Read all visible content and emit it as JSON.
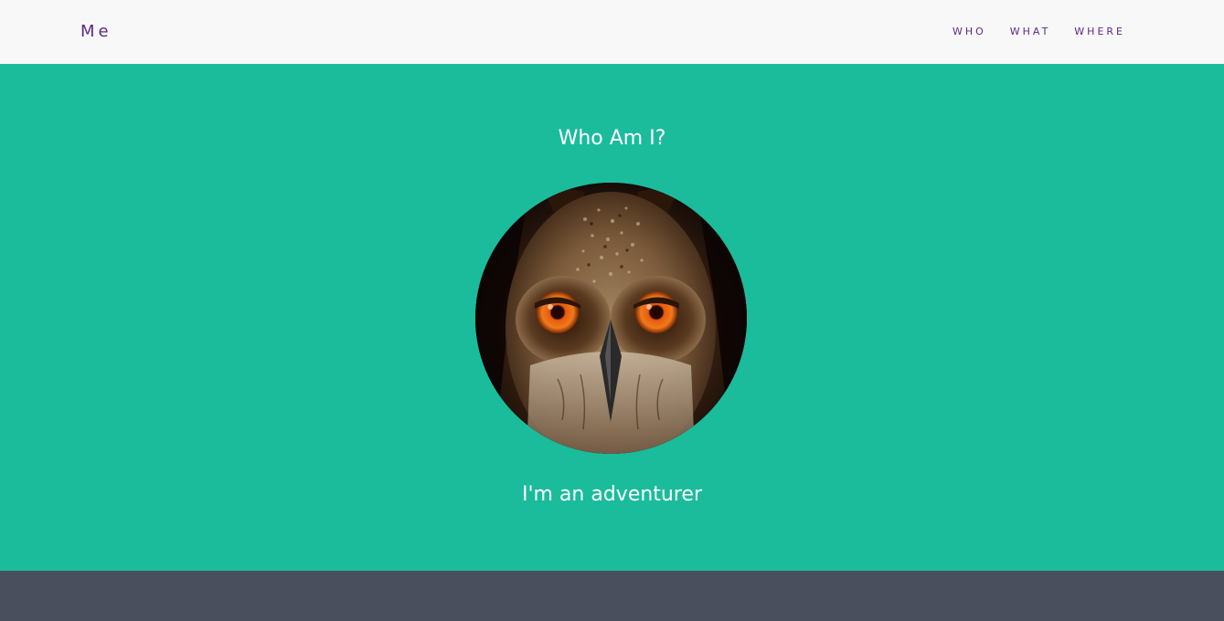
{
  "navbar": {
    "brand": "Me",
    "links": [
      {
        "label": "WHO"
      },
      {
        "label": "WHAT"
      },
      {
        "label": "WHERE"
      }
    ]
  },
  "hero": {
    "title": "Who Am I?",
    "subtitle": "I'm an adventurer",
    "avatar_subject": "owl-photo"
  },
  "colors": {
    "navbar_bg": "#f8f8f8",
    "accent_purple": "#5b2a86",
    "hero_bg": "#1abc9c",
    "dark_bg": "#4a4f5e",
    "text_light": "#ffffff"
  }
}
